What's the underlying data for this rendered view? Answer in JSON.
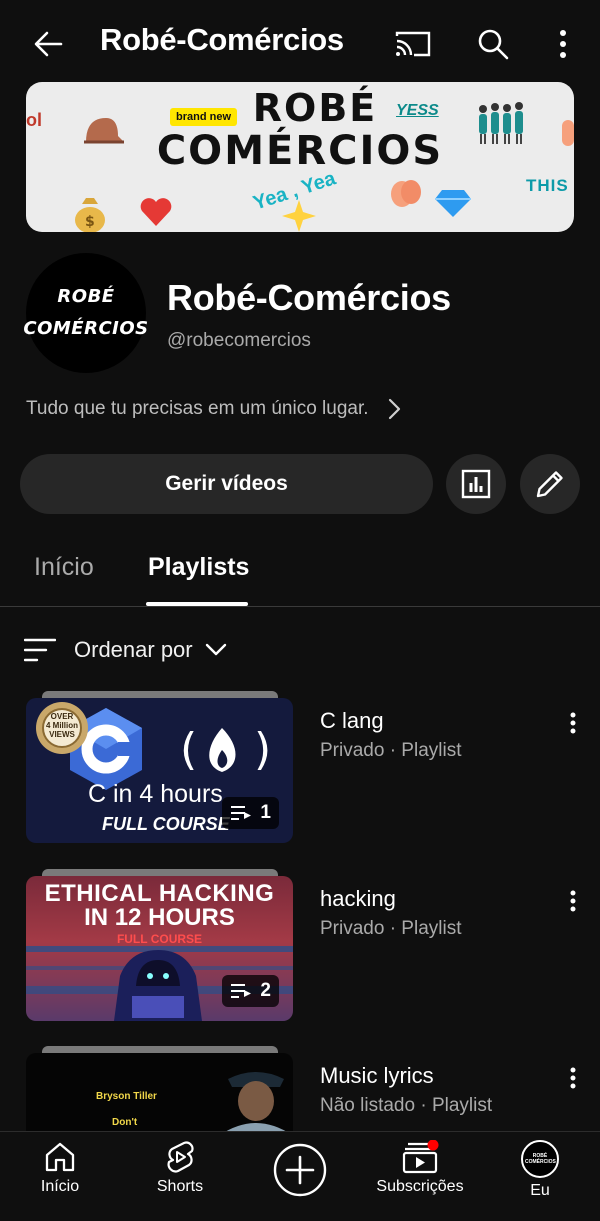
{
  "header": {
    "title": "Robé-Comércios",
    "back_icon": "arrow-left-icon",
    "cast_icon": "cast-icon",
    "search_icon": "search-icon",
    "more_icon": "more-vertical-icon"
  },
  "banner": {
    "title_line1": "ROBÉ",
    "title_line2": "COMÉRCIOS",
    "tag_brand_new": "brand new",
    "tag_yess": "YESS",
    "tag_this": "THIS",
    "tag_yea": "Yea , Yea",
    "tag_ol": "ol"
  },
  "channel": {
    "avatar_line1": "ROBÉ",
    "avatar_line2": "COMÉRCIOS",
    "name": "Robé-Comércios",
    "handle": "@robecomercios",
    "description": "Tudo que tu precisas em um único lugar."
  },
  "actions": {
    "manage_videos_label": "Gerir vídeos",
    "analytics_icon": "analytics-icon",
    "edit_icon": "pencil-icon"
  },
  "tabs": [
    {
      "label": "Início",
      "active": false
    },
    {
      "label": "Playlists",
      "active": true
    }
  ],
  "sort": {
    "label": "Ordenar por"
  },
  "playlists": [
    {
      "title": "C lang",
      "subtitle": "Privado · Playlist",
      "count": "1",
      "thumb": {
        "badge_line1": "OVER",
        "badge_line2": "4 Million",
        "badge_line3": "VIEWS",
        "line1": "C in 4 hours",
        "line2": "FULL COURSE"
      }
    },
    {
      "title": "hacking",
      "subtitle": "Privado · Playlist",
      "count": "2",
      "thumb": {
        "line1": "ETHICAL HACKING",
        "line2": "IN 12 HOURS",
        "line3": "FULL COURSE"
      }
    },
    {
      "title": "Music lyrics",
      "subtitle": "Não listado · Playlist",
      "thumb": {
        "line1": "Bryson Tiller",
        "line2": "Don't"
      }
    }
  ],
  "bottom_nav": [
    {
      "label": "Início",
      "icon": "home-icon"
    },
    {
      "label": "Shorts",
      "icon": "shorts-icon"
    },
    {
      "label": "",
      "icon": "create-icon"
    },
    {
      "label": "Subscrições",
      "icon": "subscriptions-icon"
    },
    {
      "label": "Eu",
      "icon": "avatar-icon",
      "avatar_text": "ROBÉ COMÉRCIOS"
    }
  ],
  "colors": {
    "background": "#0f0f0f",
    "surface": "#272727",
    "text_primary": "#f1f1f1",
    "text_secondary": "#aaaaaa",
    "notification": "#ff0000"
  }
}
